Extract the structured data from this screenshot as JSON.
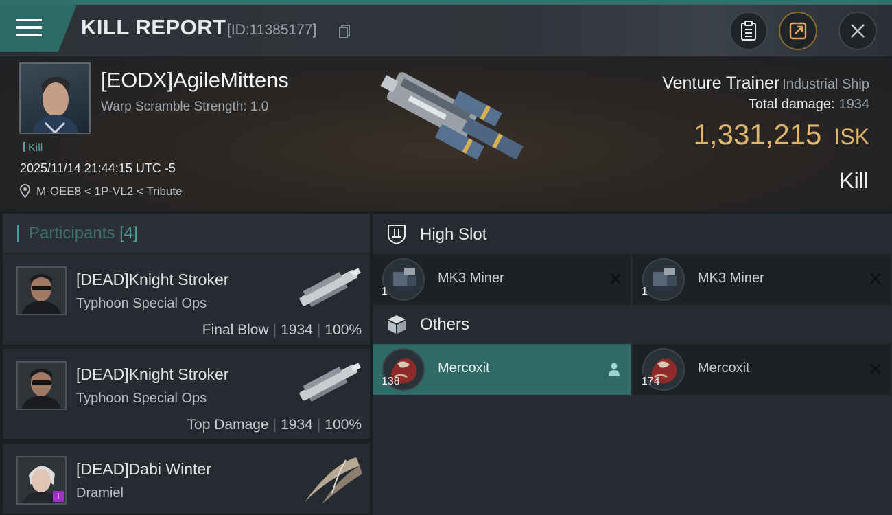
{
  "header": {
    "title": "KILL REPORT",
    "report_id": "[ID:11385177]"
  },
  "victim": {
    "name": "[EODX]AgileMittens",
    "warp_scramble": "Warp Scramble Strength: 1.0",
    "kill_tag": "Kill",
    "datetime": "2025/11/14 21:44:15 UTC -5",
    "location": "M-OEE8 < 1P-VL2 < Tribute",
    "ship_name": "Venture Trainer",
    "ship_class": "Industrial Ship",
    "total_damage_label": "Total damage:",
    "total_damage_value": "1934",
    "isk_value": "1,331,215",
    "isk_unit": "ISK",
    "result": "Kill"
  },
  "participants": {
    "title": "Participants",
    "count": "[4]",
    "items": [
      {
        "name": "[DEAD]Knight Stroker",
        "ship": "Typhoon Special Ops",
        "role": "Final Blow",
        "damage": "1934",
        "percent": "100%"
      },
      {
        "name": "[DEAD]Knight Stroker",
        "ship": "Typhoon Special Ops",
        "role": "Top Damage",
        "damage": "1934",
        "percent": "100%"
      },
      {
        "name": "[DEAD]Dabi Winter",
        "ship": "Dramiel"
      }
    ]
  },
  "fitting": {
    "high_slot": {
      "title": "High Slot",
      "items": [
        {
          "name": "MK3 Miner",
          "qty": "1"
        },
        {
          "name": "MK3 Miner",
          "qty": "1"
        }
      ]
    },
    "others": {
      "title": "Others",
      "items": [
        {
          "name": "Mercoxit",
          "qty": "138"
        },
        {
          "name": "Mercoxit",
          "qty": "174"
        }
      ]
    }
  },
  "colors": {
    "accent_teal": "#2f6a67",
    "isk_gold": "#e0b66e"
  }
}
